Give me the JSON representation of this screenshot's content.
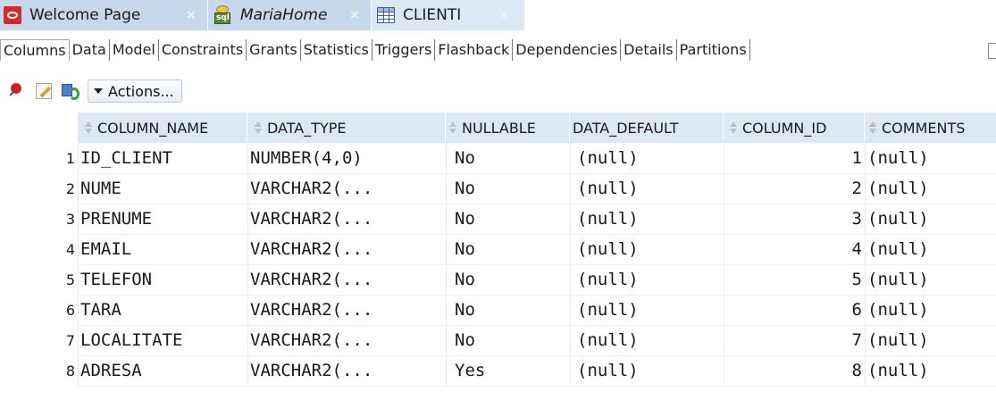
{
  "editor_tabs": [
    {
      "label": "Welcome Page",
      "icon": "oracle-icon",
      "close": "×"
    },
    {
      "label": "MariaHome",
      "icon": "sql-worksheet-icon",
      "close": "×"
    },
    {
      "label": "CLIENTI",
      "icon": "table-icon",
      "close": "×"
    }
  ],
  "sub_tabs": [
    "Columns",
    "Data",
    "Model",
    "Constraints",
    "Grants",
    "Statistics",
    "Triggers",
    "Flashback",
    "Dependencies",
    "Details",
    "Partitions"
  ],
  "toolbar": {
    "pin_icon": "pin-icon",
    "edit_icon": "edit-icon",
    "refresh_icon": "refresh-icon",
    "actions_label": "Actions..."
  },
  "columns": [
    "COLUMN_NAME",
    "DATA_TYPE",
    "NULLABLE",
    "DATA_DEFAULT",
    "COLUMN_ID",
    "COMMENTS"
  ],
  "rows": [
    {
      "n": "1",
      "name": "ID_CLIENT",
      "type": "NUMBER(4,0)",
      "nullable": "No",
      "default": "(null)",
      "id": "1",
      "comments": "(null)"
    },
    {
      "n": "2",
      "name": "NUME",
      "type": "VARCHAR2(...",
      "nullable": "No",
      "default": "(null)",
      "id": "2",
      "comments": "(null)"
    },
    {
      "n": "3",
      "name": "PRENUME",
      "type": "VARCHAR2(...",
      "nullable": "No",
      "default": "(null)",
      "id": "3",
      "comments": "(null)"
    },
    {
      "n": "4",
      "name": "EMAIL",
      "type": "VARCHAR2(...",
      "nullable": "No",
      "default": "(null)",
      "id": "4",
      "comments": "(null)"
    },
    {
      "n": "5",
      "name": "TELEFON",
      "type": "VARCHAR2(...",
      "nullable": "No",
      "default": "(null)",
      "id": "5",
      "comments": "(null)"
    },
    {
      "n": "6",
      "name": "TARA",
      "type": "VARCHAR2(...",
      "nullable": "No",
      "default": "(null)",
      "id": "6",
      "comments": "(null)"
    },
    {
      "n": "7",
      "name": "LOCALITATE",
      "type": "VARCHAR2(...",
      "nullable": "No",
      "default": "(null)",
      "id": "7",
      "comments": "(null)"
    },
    {
      "n": "8",
      "name": "ADRESA",
      "type": "VARCHAR2(...",
      "nullable": "Yes",
      "default": "(null)",
      "id": "8",
      "comments": "(null)"
    }
  ]
}
